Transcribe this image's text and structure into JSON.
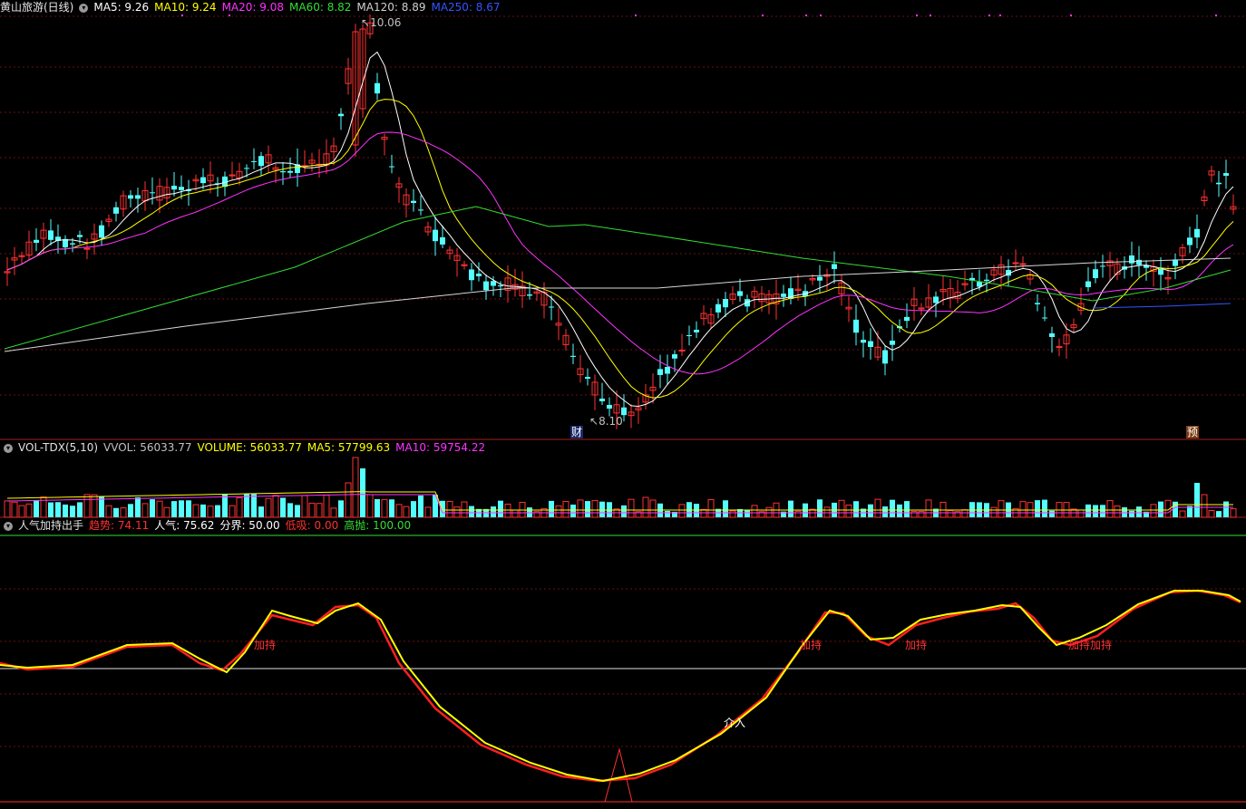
{
  "main": {
    "title": "黄山旅游(日线)",
    "ma_items": [
      {
        "label": "MA5: 9.26",
        "color": "#ffffff"
      },
      {
        "label": "MA10: 9.24",
        "color": "#ffff00"
      },
      {
        "label": "MA20: 9.08",
        "color": "#ff33ff"
      },
      {
        "label": "MA60: 8.82",
        "color": "#33dd33"
      },
      {
        "label": "MA120: 8.89",
        "color": "#d0d0d0"
      },
      {
        "label": "MA250: 8.67",
        "color": "#3355ff"
      }
    ],
    "high_label": "10.06",
    "low_label": "8.10",
    "event_cai": "财",
    "event_yu": "预"
  },
  "volume": {
    "title": "VOL-TDX(5,10)",
    "items": [
      {
        "label": "VVOL: 56033.77",
        "color": "#c0c0c0"
      },
      {
        "label": "VOLUME: 56033.77",
        "color": "#ffff00"
      },
      {
        "label": "MA5: 57799.63",
        "color": "#ffff00"
      },
      {
        "label": "MA10: 59754.22",
        "color": "#ff33ff"
      }
    ]
  },
  "indicator": {
    "title": "人气加持出手",
    "items": [
      {
        "label": "趋势: 74.11",
        "color": "#ff3030"
      },
      {
        "label": "人气: 75.62",
        "color": "#ffffff"
      },
      {
        "label": "分界: 50.00",
        "color": "#ffffff"
      },
      {
        "label": "低吸: 0.00",
        "color": "#ff3030"
      },
      {
        "label": "高抛: 100.00",
        "color": "#33dd33"
      }
    ],
    "signals": [
      {
        "text": "加持",
        "color": "#ff3030"
      },
      {
        "text": "加持",
        "color": "#ff3030"
      },
      {
        "text": "加持",
        "color": "#ff3030"
      },
      {
        "text": "加持加持",
        "color": "#ff3030"
      },
      {
        "text": "介入",
        "color": "#ffffff"
      }
    ]
  },
  "chart_data": {
    "type": "candlestick",
    "price_levels": {
      "high": 10.06,
      "low": 8.1
    },
    "moving_averages": {
      "MA5": 9.26,
      "MA10": 9.24,
      "MA20": 9.08,
      "MA60": 8.82,
      "MA120": 8.89,
      "MA250": 8.67
    },
    "volume_indicator": {
      "VVOL": 56033.77,
      "VOLUME": 56033.77,
      "MA5": 57799.63,
      "MA10": 59754.22
    },
    "popularity_indicator": {
      "趋势": 74.11,
      "人气": 75.62,
      "分界": 50.0,
      "低吸": 0.0,
      "高抛": 100.0
    },
    "colors": {
      "up": "#ff3232",
      "down": "#54ffff",
      "background": "#000000"
    }
  }
}
